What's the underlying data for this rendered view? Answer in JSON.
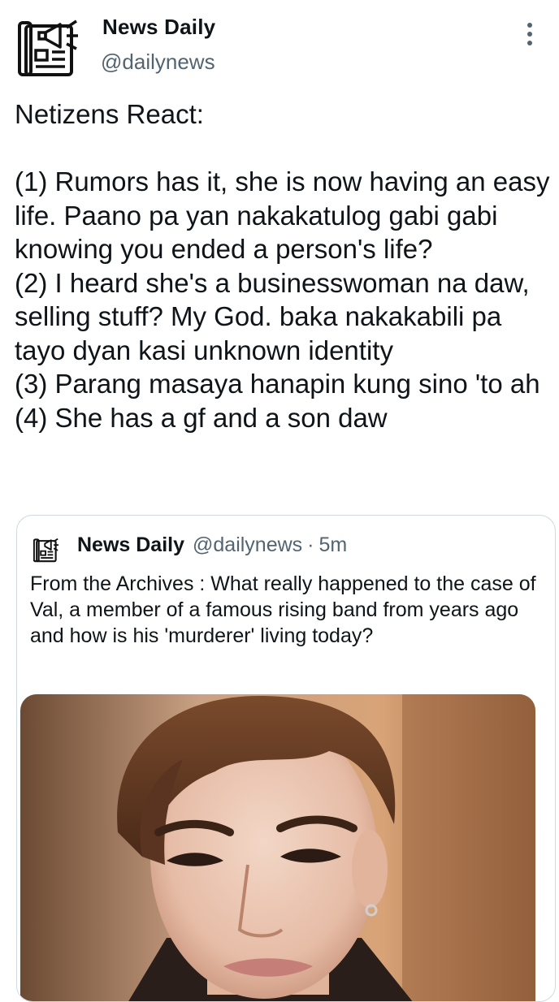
{
  "tweet": {
    "author": {
      "name": "News Daily",
      "handle": "@dailynews",
      "avatar_icon": "newspaper-megaphone-icon"
    },
    "more_icon": "more-vertical-icon",
    "text": "Netizens React:\n\n(1) Rumors has it, she is now having an easy life. Paano pa yan nakakatulog gabi gabi knowing you ended a person's life?\n(2) I heard she's a businesswoman na daw, selling stuff? My God. baka nakakabili pa tayo dyan kasi unknown identity\n(3) Parang masaya hanapin kung sino 'to ah\n(4) She has a gf and a son daw"
  },
  "quote": {
    "author": {
      "name": "News Daily",
      "handle": "@dailynews",
      "avatar_icon": "newspaper-megaphone-icon"
    },
    "separator": "·",
    "time": "5m",
    "text": "From the Archives : What really happened to the case of Val, a member of a famous rising band from years ago and how is his 'murderer' living today?",
    "media": "portrait-photo"
  },
  "colors": {
    "text_primary": "#0f1419",
    "text_secondary": "#536471",
    "border": "#cfd9de",
    "background": "#ffffff"
  }
}
